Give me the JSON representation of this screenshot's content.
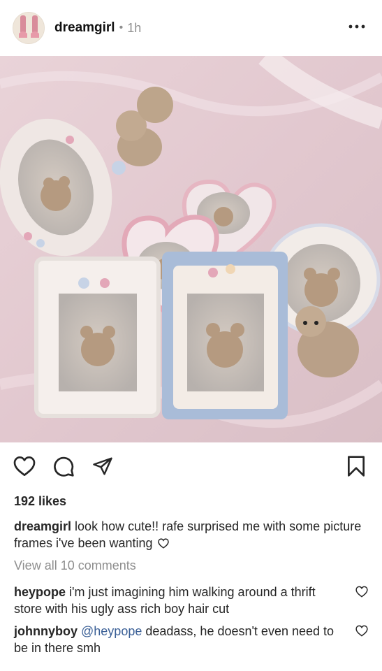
{
  "post": {
    "username": "dreamgirl",
    "separator": "•",
    "time": "1h",
    "likes": "192 likes",
    "caption_user": "dreamgirl",
    "caption_text": "look how cute!! rafe surprised me with some picture frames i've been wanting",
    "view_all": "View all 10 comments"
  },
  "comments": [
    {
      "user": "heypope",
      "mention": "",
      "text": "i'm just imagining him walking around a thrift store with his ugly ass rich boy hair cut"
    },
    {
      "user": "johnnyboy",
      "mention": "@heypope",
      "text": "deadass, he doesn't even need to be in there smh"
    }
  ],
  "icons": {
    "header": "more-options-icon",
    "actions": [
      "heart-icon",
      "comment-icon",
      "share-icon",
      "bookmark-icon"
    ]
  },
  "colors": {
    "text": "#262626",
    "secondary": "#8e8e8e",
    "mention": "#3a5f96"
  }
}
